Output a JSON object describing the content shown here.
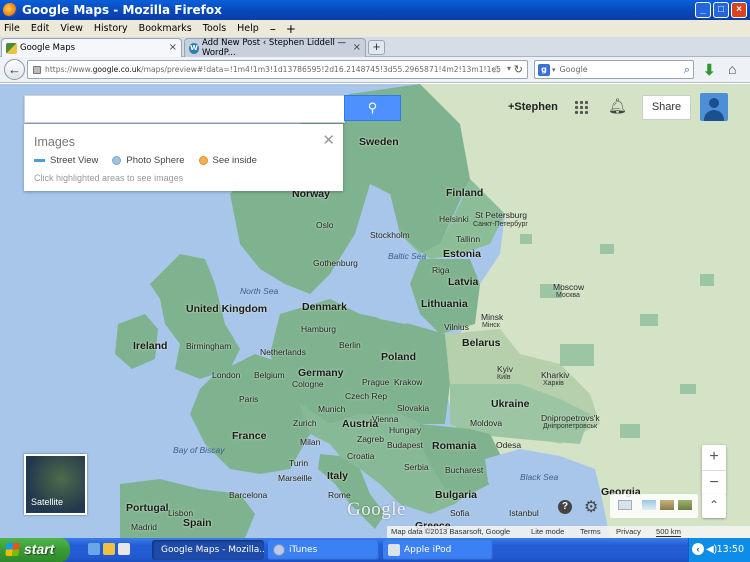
{
  "window": {
    "title": "Google Maps - Mozilla Firefox",
    "min": "_",
    "max": "□",
    "close": "×"
  },
  "menu": [
    "File",
    "Edit",
    "View",
    "History",
    "Bookmarks",
    "Tools",
    "Help"
  ],
  "menu_extra": {
    "minus": "–",
    "plus": "+"
  },
  "tabs": [
    {
      "label": "Google Maps",
      "close": "×"
    },
    {
      "label": "Add New Post ‹ Stephen Liddell — WordP...",
      "close": "×"
    }
  ],
  "new_tab": "+",
  "nav": {
    "back": "←",
    "url_prefix": "https://www.",
    "url_domain": "google.co.uk",
    "url_path": "/maps/preview#!data=!1m4!1m3!1d13786595!2d16.2148745!3d55.2965871!4m2!13m1!1e5",
    "star": "☆",
    "dropdown": "▾",
    "reload": "↻",
    "search_engine": "g",
    "search_placeholder": "Google",
    "search_go": "⌕",
    "download": "⬇",
    "home": "⌂"
  },
  "maps": {
    "search_value": "",
    "search_icon": "⚲",
    "images_panel": {
      "title": "Images",
      "close": "✕",
      "legend": [
        {
          "label": "Street View",
          "color": "#4c9ed4",
          "kind": "line"
        },
        {
          "label": "Photo Sphere",
          "color": "#9dc3de",
          "kind": "dot"
        },
        {
          "label": "See inside",
          "color": "#f2b14f",
          "kind": "dot"
        }
      ],
      "hint": "Click highlighted areas to see images"
    },
    "user": "+Stephen",
    "share": "Share",
    "satellite": "Satellite",
    "zoom_in": "+",
    "zoom_out": "−",
    "help": "?",
    "settings": "⚙",
    "expand": "⌃",
    "logo": "Google",
    "footer": {
      "copyright": "Map data ©2013 Basarsoft, Google",
      "lite": "Lite mode",
      "terms": "Terms",
      "privacy": "Privacy",
      "scale": "500 km"
    },
    "labels": {
      "countries": [
        "Sweden",
        "Norway",
        "Finland",
        "Estonia",
        "Latvia",
        "Lithuania",
        "Belarus",
        "Poland",
        "Germany",
        "United Kingdom",
        "Ireland",
        "Netherlands",
        "Belgium",
        "Denmark",
        "France",
        "Austria",
        "Czech Rep",
        "Slovakia",
        "Hungary",
        "Romania",
        "Ukraine",
        "Moldova",
        "Croatia",
        "Serbia",
        "Bulgaria",
        "Italy",
        "Spain",
        "Portugal",
        "Greece",
        "Georgia"
      ],
      "cities": [
        "Oslo",
        "Stockholm",
        "Helsinki",
        "St Petersburg",
        "Tallinn",
        "Gothenburg",
        "Riga",
        "Moscow",
        "Minsk",
        "Vilnius",
        "Hamburg",
        "Berlin",
        "Birmingham",
        "London",
        "Paris",
        "Cologne",
        "Prague",
        "Krakow",
        "Kyiv",
        "Kharkiv",
        "Munich",
        "Vienna",
        "Zurich",
        "Milan",
        "Turin",
        "Zagreb",
        "Budapest",
        "Dnipropetrovs'k",
        "Odesa",
        "Bucharest",
        "Marseille",
        "Rome",
        "Barcelona",
        "Madrid",
        "Lisbon",
        "Sofia",
        "Istanbul"
      ],
      "sub": [
        "Санкт-Петербург",
        "Москва",
        "Мінск",
        "Київ",
        "Харків",
        "Дніпропетровськ"
      ],
      "seas": [
        "North Sea",
        "Baltic Sea",
        "Bay of Biscay",
        "Black Sea"
      ]
    }
  },
  "taskbar": {
    "start": "start",
    "tasks": [
      "Google Maps - Mozilla...",
      "iTunes",
      "Apple iPod"
    ],
    "clock": "13:50"
  },
  "colors": {
    "water": "#a8c6ea",
    "land": "#cfe0c3",
    "sv_coverage": "#7fb38f",
    "accent_blue": "#4d90fe",
    "xp_blue": "#245ed6",
    "start_green": "#3a9b36"
  }
}
